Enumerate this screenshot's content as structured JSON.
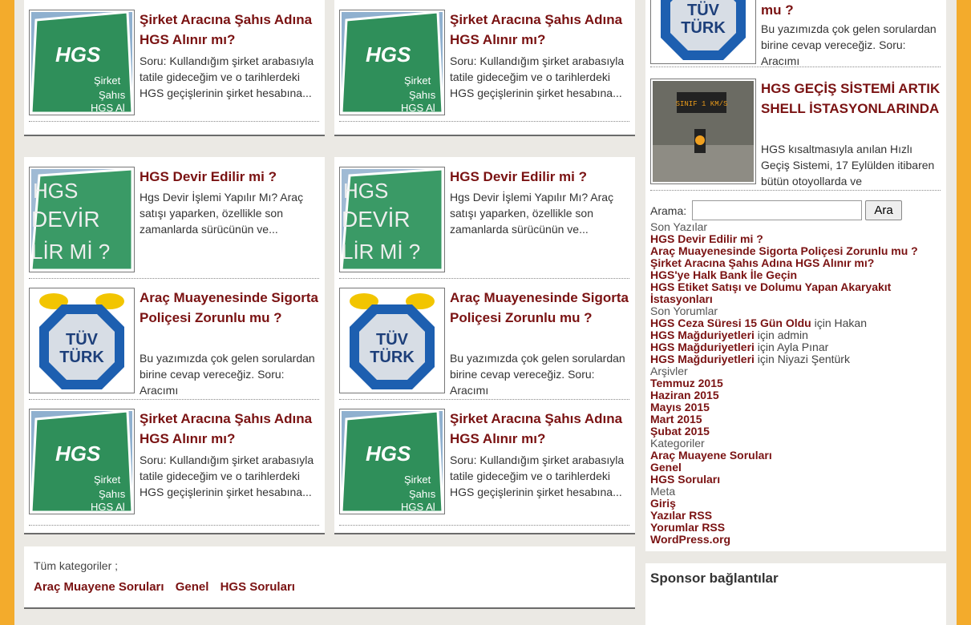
{
  "posts": {
    "hgs": {
      "title": "Şirket Aracına Şahıs Adına HGS Alınır mı?",
      "excerpt": "Soru: Kullandığım şirket arabasıyla tatile gideceğim ve o tarihlerdeki HGS geçişlerinin şirket hesabına..."
    },
    "devir": {
      "title": "HGS Devir Edilir mi ?",
      "excerpt": "Hgs Devir İşlemi Yapılır Mı? Araç satışı yaparken, özellikle son zamanlarda sürücünün ve..."
    },
    "tuv": {
      "title": "Araç Muayenesinde Sigorta Poliçesi Zorunlu mu ?",
      "excerpt": "Bu yazımızda çok gelen sorulardan birine cevap vereceğiz. Soru: Aracımı"
    }
  },
  "sidebar_posts": {
    "top": {
      "title": "mu ?",
      "excerpt": "Bu yazımızda çok gelen sorulardan birine cevap vereceğiz. Soru: Aracımı"
    },
    "shell": {
      "title": "HGS GEÇİŞ SİSTEMİ ARTIK SHELL İSTASYONLARINDA",
      "excerpt": "HGS kısaltmasıyla anılan Hızlı Geçiş Sistemi, 17 Eylülden itibaren bütün otoyollarda ve"
    }
  },
  "thumbs": {
    "hgs_text": "HGS",
    "hgs_sign1": "Şirket",
    "hgs_sign2": "Şahıs",
    "hgs_sign3": "HGS Al",
    "devir_line1": "HGS",
    "devir_line2": "DEVİR",
    "devir_line3": "LİR Mİ ?",
    "tuv_line1": "TÜV",
    "tuv_line2": "TÜRK",
    "shell_sign": "SINIF 1 KM/S"
  },
  "categories_box": {
    "label": "Tüm kategoriler ;",
    "links": [
      "Araç Muayene Soruları",
      "Genel",
      "HGS Soruları"
    ]
  },
  "search": {
    "label": "Arama:",
    "value": "",
    "button": "Ara"
  },
  "widgets": {
    "recent_posts_title": "Son Yazılar",
    "recent_posts": [
      "HGS Devir Edilir mi ?",
      "Araç Muayenesinde Sigorta Poliçesi Zorunlu mu ?",
      "Şirket Aracına Şahıs Adına HGS Alınır mı?",
      "HGS'ye Halk Bank İle Geçin",
      "HGS Etiket Satışı ve Dolumu Yapan Akaryakıt İstasyonları"
    ],
    "recent_comments_title": "Son Yorumlar",
    "recent_comments": [
      {
        "post": "HGS Ceza Süresi 15 Gün Oldu",
        "sep": " için ",
        "author": "Hakan"
      },
      {
        "post": "HGS Mağduriyetleri",
        "sep": " için ",
        "author": "admin"
      },
      {
        "post": "HGS Mağduriyetleri",
        "sep": " için ",
        "author": "Ayla Pınar"
      },
      {
        "post": "HGS Mağduriyetleri",
        "sep": " için ",
        "author": "Niyazi Şentürk"
      }
    ],
    "archives_title": "Arşivler",
    "archives": [
      "Temmuz 2015",
      "Haziran 2015",
      "Mayıs 2015",
      "Mart 2015",
      "Şubat 2015"
    ],
    "categories_title": "Kategoriler",
    "categories": [
      "Araç Muayene Soruları",
      "Genel",
      "HGS Soruları"
    ],
    "meta_title": "Meta",
    "meta": [
      "Giriş",
      "Yazılar RSS",
      "Yorumlar RSS",
      "WordPress.org"
    ]
  },
  "sponsor": {
    "title": "Sponsor bağlantılar"
  },
  "colors": {
    "outer_bg": "#f3ab2c",
    "page_bg": "#ebe9e4",
    "link": "#7a1212"
  }
}
